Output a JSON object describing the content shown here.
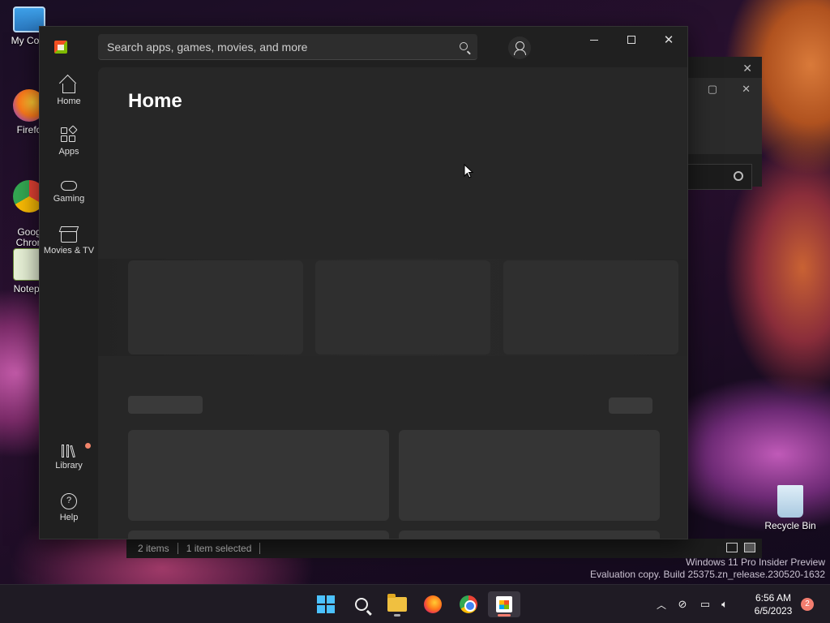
{
  "desktop": {
    "icons": [
      {
        "label": "My Com"
      },
      {
        "label": "Firefo"
      },
      {
        "label": "Goog\nChron"
      },
      {
        "label": "Notepa"
      }
    ],
    "recycle_bin": "Recycle Bin",
    "watermark_line1": "Windows 11 Pro Insider Preview",
    "watermark_line2": "Evaluation copy. Build 25375.zn_release.230520-1632"
  },
  "explorer": {
    "status_items": "2 items",
    "status_selected": "1 item selected"
  },
  "store": {
    "search_placeholder": "Search apps, games, movies, and more",
    "page_title": "Home",
    "nav": [
      {
        "label": "Home",
        "icon": "home-icon"
      },
      {
        "label": "Apps",
        "icon": "apps-icon"
      },
      {
        "label": "Gaming",
        "icon": "gaming-icon"
      },
      {
        "label": "Movies & TV",
        "icon": "movies-icon"
      }
    ],
    "nav_bottom": [
      {
        "label": "Library",
        "icon": "library-icon"
      },
      {
        "label": "Help",
        "icon": "help-icon"
      }
    ]
  },
  "taskbar": {
    "time": "6:56 AM",
    "date": "6/5/2023",
    "notification_count": "2"
  }
}
